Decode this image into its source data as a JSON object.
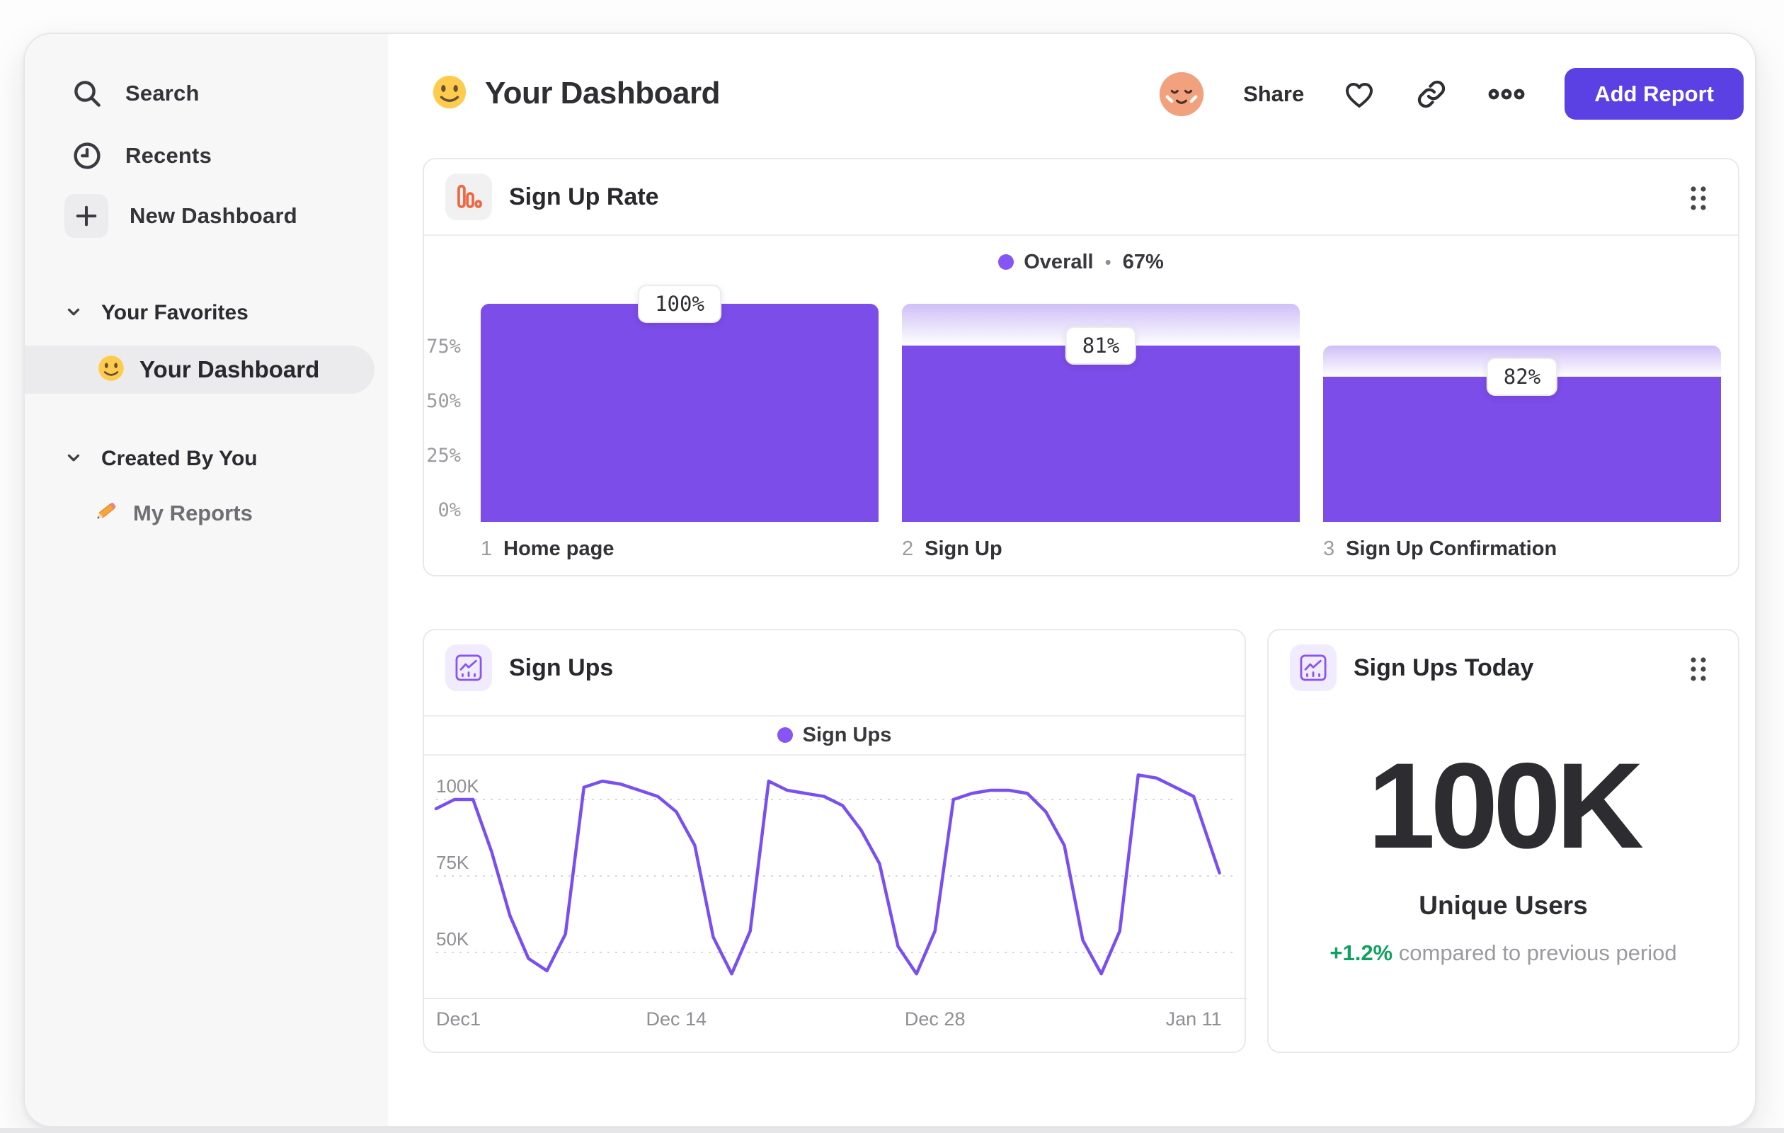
{
  "sidebar": {
    "nav": [
      {
        "label": "Search",
        "icon": "search-icon"
      },
      {
        "label": "Recents",
        "icon": "clock-icon"
      },
      {
        "label": "New Dashboard",
        "icon": "plus-icon"
      }
    ],
    "sections": [
      {
        "title": "Your Favorites",
        "items": [
          {
            "label": "Your Dashboard",
            "icon": "smiley-emoji",
            "selected": true
          }
        ]
      },
      {
        "title": "Created By You",
        "items": [
          {
            "label": "My Reports",
            "icon": "pencil-emoji",
            "selected": false
          }
        ]
      }
    ]
  },
  "header": {
    "title": "Your Dashboard",
    "title_emoji": "smiley-emoji",
    "share_label": "Share",
    "add_report_label": "Add Report"
  },
  "cards": {
    "sign_up_rate": {
      "title": "Sign Up Rate",
      "icon": "funnel-chart-icon"
    },
    "sign_ups": {
      "title": "Sign Ups",
      "icon": "line-chart-icon"
    },
    "sign_ups_today": {
      "title": "Sign Ups Today",
      "icon": "line-chart-icon",
      "metric_value": "100K",
      "metric_label": "Unique Users",
      "delta": "+1.2%",
      "delta_note": "compared to previous period"
    }
  },
  "chart_data": [
    {
      "type": "bar",
      "variant": "funnel",
      "title": "Sign Up Rate",
      "legend": {
        "label": "Overall",
        "separator": "•",
        "value": "67%",
        "position": "top-center",
        "color": "#8655F6"
      },
      "categories": [
        "Home page",
        "Sign Up",
        "Sign Up Confirmation"
      ],
      "step_numbers": [
        "1",
        "2",
        "3"
      ],
      "value_labels": [
        "100%",
        "81%",
        "82%"
      ],
      "conversion_from_previous_pct": [
        100,
        81,
        82
      ],
      "absolute_pct": [
        100,
        81,
        66.4
      ],
      "y_ticks": [
        {
          "label": "75%",
          "value": 75
        },
        {
          "label": "50%",
          "value": 50
        },
        {
          "label": "25%",
          "value": 25
        },
        {
          "label": "0%",
          "value": 0
        }
      ],
      "ylim": [
        0,
        100
      ],
      "bar_color": "#7C4DE8",
      "grid": false
    },
    {
      "type": "line",
      "title": "Sign Ups",
      "legend": {
        "label": "Sign Ups",
        "position": "top-center",
        "color": "#8655F6"
      },
      "x_ticks": [
        {
          "label": "Dec1",
          "day": 0,
          "align": "left"
        },
        {
          "label": "Dec 14",
          "day": 13,
          "align": "center"
        },
        {
          "label": "Dec 28",
          "day": 27,
          "align": "center"
        },
        {
          "label": "Jan 11",
          "day": 41,
          "align": "center"
        }
      ],
      "y_ticks": [
        {
          "label": "100K",
          "value": 100
        },
        {
          "label": "75K",
          "value": 75
        },
        {
          "label": "50K",
          "value": 50
        }
      ],
      "unit": "thousands of sign ups per day",
      "values_thousands": [
        97,
        100,
        100,
        83,
        62,
        48,
        44,
        56,
        104,
        106,
        105,
        103,
        101,
        96,
        85,
        55,
        43,
        57,
        106,
        103,
        102,
        101,
        98,
        90,
        79,
        52,
        43,
        57,
        100,
        102,
        103,
        103,
        102,
        96,
        85,
        54,
        43,
        57,
        108,
        107,
        104,
        101,
        76
      ],
      "final_point_day": 42.4,
      "ylim_displayed": [
        50,
        100
      ],
      "line_color": "#7A4FF0",
      "grid": "dashed horizontal"
    }
  ],
  "colors": {
    "bar_purple": "#7C4DE8",
    "line_purple": "#7A4FF0",
    "legend_dot_purple": "#8655F6",
    "button_purple": "#5B40E4",
    "positive_green": "#10A060",
    "funnel_icon_orange": "#F0653E",
    "sidebar_bg": "#F7F7F8"
  }
}
